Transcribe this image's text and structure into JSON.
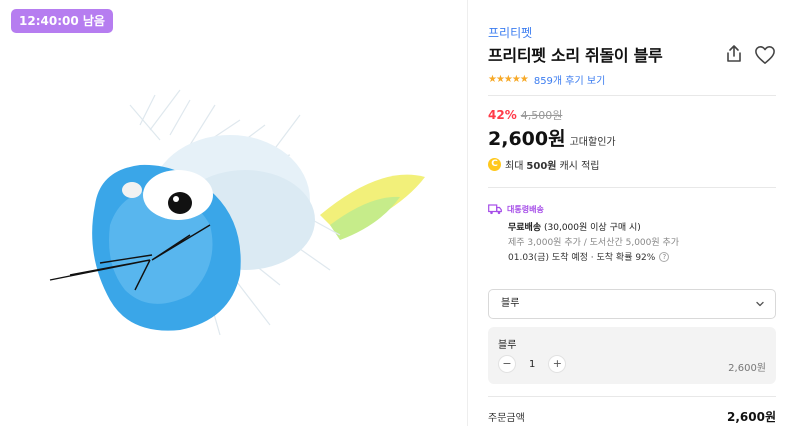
{
  "timer": "12:40:00 남음",
  "product": {
    "brand": "프리티펫",
    "title": "프리티펫 소리 쥐돌이 블루",
    "rating_stars": "★★★★★",
    "review_link": "859개 후기 보기",
    "discount": "42%",
    "original_price": "4,500원",
    "price": "2,600원",
    "price_label": "고대할인가"
  },
  "cash": {
    "coin": "C",
    "prefix": "최대",
    "amount": "500원",
    "suffix": "캐시 적립"
  },
  "shipping": {
    "type": "대통령배송",
    "free_bold": "무료배송",
    "free_rest": "(30,000원 이상 구매 시)",
    "extra": "제주 3,000원 추가 / 도서산간 5,000원 추가",
    "eta": "01.03(금) 도착 예정 · 도착 확률 92%",
    "help": "?"
  },
  "option_select": {
    "value": "블루"
  },
  "selected_option": {
    "name": "블루",
    "minus": "−",
    "quantity": "1",
    "plus": "+",
    "price": "2,600원"
  },
  "total": {
    "label": "주문금액",
    "price": "2,600원"
  },
  "colors": {
    "brand_blue": "#3c7df0",
    "discount_red": "#ff3b49",
    "timer_purple": "#b67df0",
    "shipping_purple": "#a64ee8",
    "star_orange": "#f7a928"
  },
  "icons": [
    "share-icon",
    "heart-icon",
    "coin-icon",
    "truck-icon",
    "chevron-down-icon",
    "help-icon"
  ]
}
